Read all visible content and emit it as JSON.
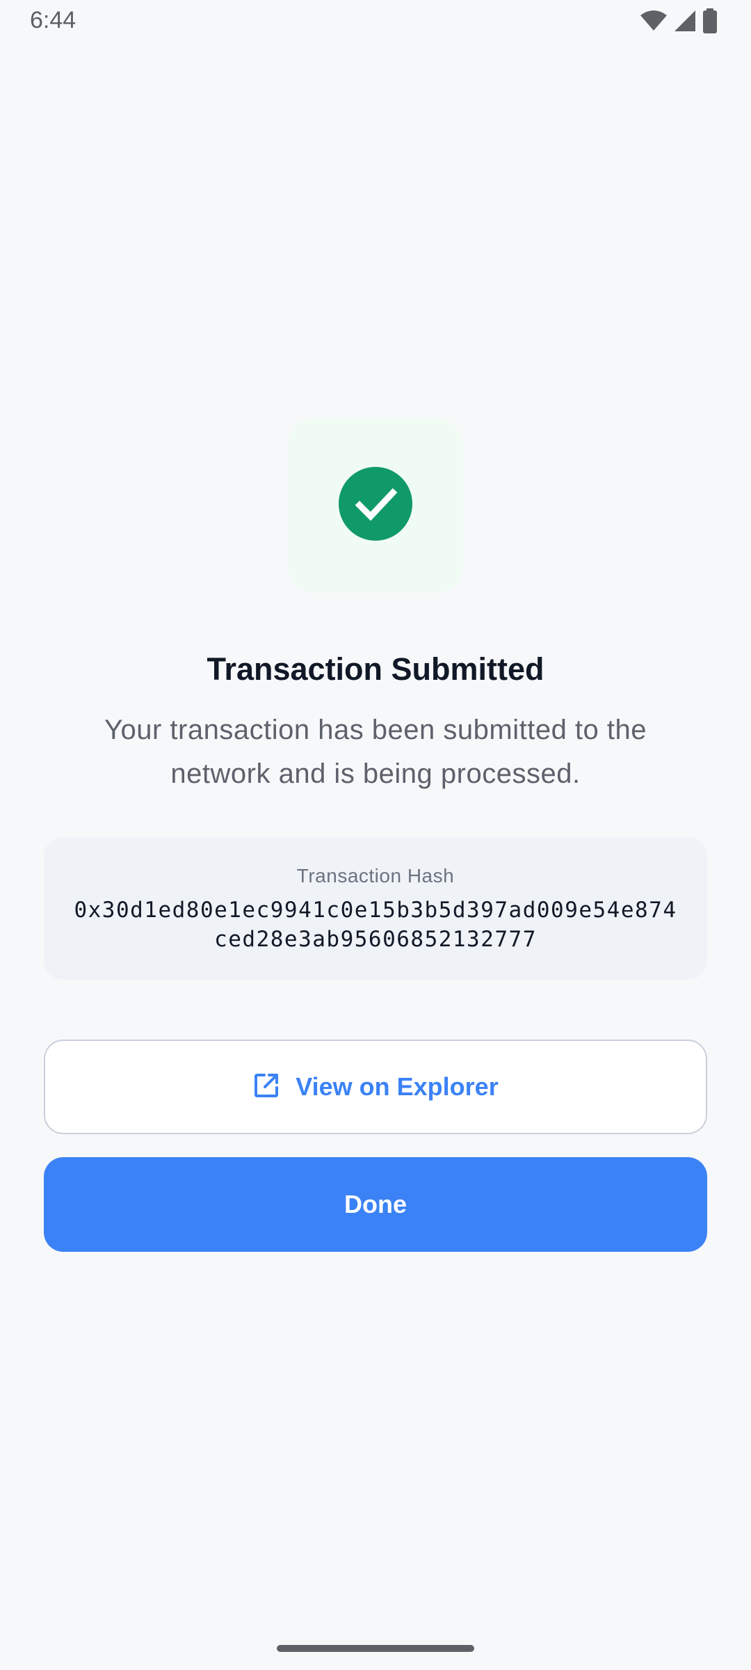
{
  "status_bar": {
    "time": "6:44",
    "icons": [
      "wifi-icon",
      "cellular-signal-icon",
      "battery-icon"
    ]
  },
  "success": {
    "icon": "check-circle-icon",
    "tile_color": "#effbf3",
    "icon_color": "#0f9a68"
  },
  "title": "Transaction Submitted",
  "subtitle": "Your transaction has been submitted to the network and is being processed.",
  "hash_card": {
    "label": "Transaction Hash",
    "value": "0x30d1ed80e1ec9941c0e15b3b5d397ad009e54e874ced28e3ab95606852132777"
  },
  "buttons": {
    "explorer": {
      "label": "View on Explorer",
      "icon": "open-in-new-icon"
    },
    "done": {
      "label": "Done"
    }
  },
  "colors": {
    "accent": "#3b82f6",
    "background": "#f7f8fa",
    "title_text": "#111827",
    "body_text": "#5c616b"
  }
}
